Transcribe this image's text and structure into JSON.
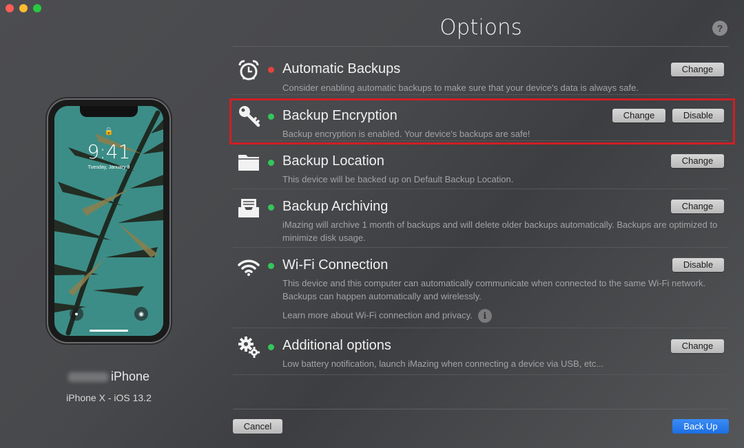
{
  "window": {
    "title": "Options",
    "help_label": "?"
  },
  "device": {
    "phone_time": "9:41",
    "phone_date": "Tuesday, January 9",
    "name_suffix": "iPhone",
    "model": "iPhone X - iOS 13.2"
  },
  "options": [
    {
      "id": "automatic-backups",
      "icon": "alarm-clock-icon",
      "status": "red",
      "title": "Automatic Backups",
      "description": "Consider enabling automatic backups to make sure that your device's data is always safe.",
      "buttons": [
        "Change"
      ]
    },
    {
      "id": "backup-encryption",
      "icon": "key-icon",
      "status": "green",
      "title": "Backup Encryption",
      "description": "Backup encryption is enabled. Your device's backups are safe!",
      "buttons": [
        "Change",
        "Disable"
      ]
    },
    {
      "id": "backup-location",
      "icon": "folder-icon",
      "status": "green",
      "title": "Backup Location",
      "description": "This device will be backed up on Default Backup Location.",
      "buttons": [
        "Change"
      ]
    },
    {
      "id": "backup-archiving",
      "icon": "archive-tray-icon",
      "status": "green",
      "title": "Backup Archiving",
      "description": "iMazing will archive 1 month of backups and will delete older backups automatically. Backups are optimized to minimize disk usage.",
      "buttons": [
        "Change"
      ]
    },
    {
      "id": "wifi-connection",
      "icon": "wifi-icon",
      "status": "green",
      "title": "Wi-Fi Connection",
      "description": "This device and this computer can automatically communicate when connected to the same Wi-Fi network. Backups can happen automatically and wirelessly.",
      "link": "Learn more about Wi-Fi connection and privacy.",
      "info_label": "i",
      "buttons": [
        "Disable"
      ]
    },
    {
      "id": "additional-options",
      "icon": "gears-icon",
      "status": "green",
      "title": "Additional options",
      "description": "Low battery notification, launch iMazing when connecting a device via USB, etc...",
      "buttons": [
        "Change"
      ]
    }
  ],
  "footer": {
    "cancel_label": "Cancel",
    "backup_label": "Back Up"
  },
  "colors": {
    "status_red": "#e0443e",
    "status_green": "#34c75a",
    "highlight_border": "#cf1f26",
    "primary_button": "#1b6fe3"
  }
}
